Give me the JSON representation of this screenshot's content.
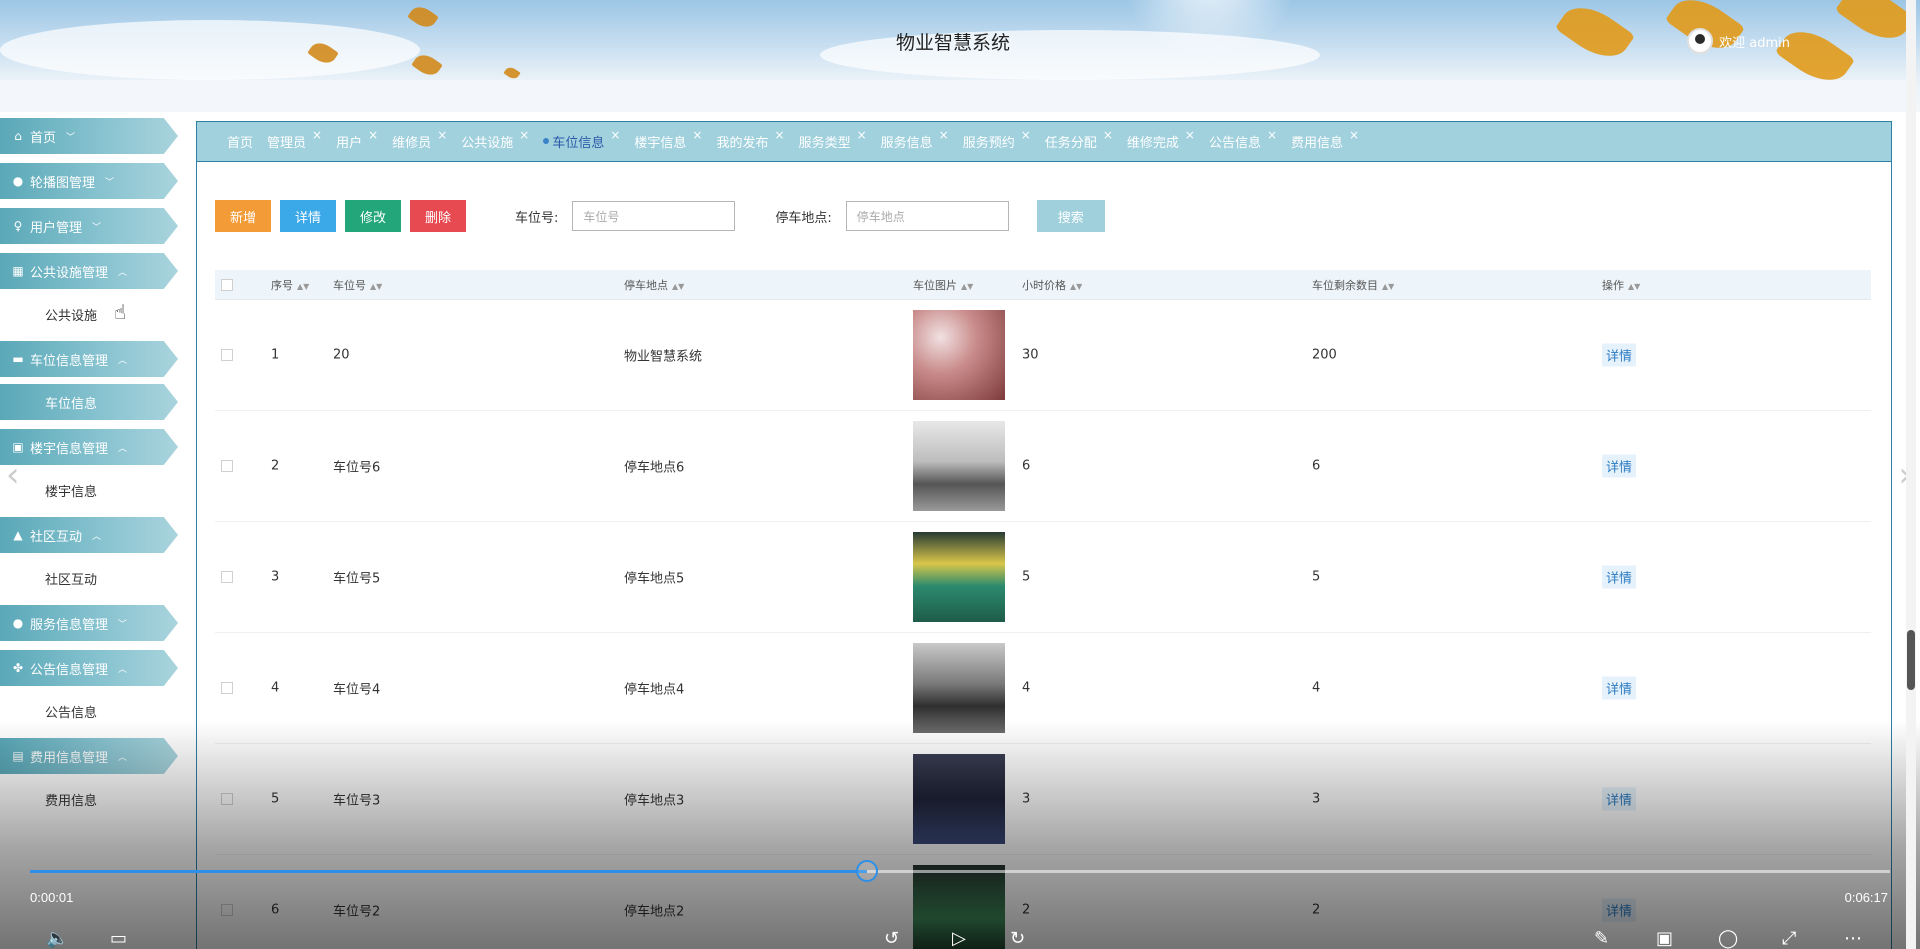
{
  "header": {
    "title": "物业智慧系统",
    "welcome": "欢迎 admin"
  },
  "sidebar": [
    {
      "label": "首页",
      "icon": "home-icon",
      "expanded": false,
      "children": []
    },
    {
      "label": "轮播图管理",
      "icon": "image-icon",
      "expanded": false,
      "children": []
    },
    {
      "label": "用户管理",
      "icon": "user-icon",
      "expanded": false,
      "children": []
    },
    {
      "label": "公共设施管理",
      "icon": "grid-icon",
      "expanded": true,
      "children": [
        "公共设施"
      ]
    },
    {
      "label": "车位信息管理",
      "icon": "car-icon",
      "expanded": true,
      "children": [
        "车位信息"
      ]
    },
    {
      "label": "楼宇信息管理",
      "icon": "building-icon",
      "expanded": true,
      "children": [
        "楼宇信息"
      ]
    },
    {
      "label": "社区互动",
      "icon": "thumb-icon",
      "expanded": true,
      "children": [
        "社区互动"
      ]
    },
    {
      "label": "服务信息管理",
      "icon": "service-icon",
      "expanded": false,
      "children": []
    },
    {
      "label": "公告信息管理",
      "icon": "notice-icon",
      "expanded": true,
      "children": [
        "公告信息"
      ]
    },
    {
      "label": "费用信息管理",
      "icon": "fee-icon",
      "expanded": true,
      "children": [
        "费用信息"
      ]
    }
  ],
  "sidebar_active_child": "车位信息",
  "tabs": [
    "首页",
    "管理员",
    "用户",
    "维修员",
    "公共设施",
    "车位信息",
    "楼宇信息",
    "我的发布",
    "服务类型",
    "服务信息",
    "服务预约",
    "任务分配",
    "维修完成",
    "公告信息",
    "费用信息"
  ],
  "active_tab": "车位信息",
  "toolbar": {
    "add": "新增",
    "detail": "详情",
    "edit": "修改",
    "delete": "删除",
    "field1_label": "车位号:",
    "field1_placeholder": "车位号",
    "field2_label": "停车地点:",
    "field2_placeholder": "停车地点",
    "search": "搜索"
  },
  "table": {
    "headers": [
      "序号",
      "车位号",
      "停车地点",
      "车位图片",
      "小时价格",
      "车位剩余数目",
      "操作"
    ],
    "rows": [
      {
        "no": "1",
        "code": "20",
        "place": "物业智慧系统",
        "price": "30",
        "remain": "200",
        "action": "详情",
        "img": "flowers"
      },
      {
        "no": "2",
        "code": "车位号6",
        "place": "停车地点6",
        "price": "6",
        "remain": "6",
        "action": "详情",
        "img": "garage-white"
      },
      {
        "no": "3",
        "code": "车位号5",
        "place": "停车地点5",
        "price": "5",
        "remain": "5",
        "action": "详情",
        "img": "garage-green"
      },
      {
        "no": "4",
        "code": "车位号4",
        "place": "停车地点4",
        "price": "4",
        "remain": "4",
        "action": "详情",
        "img": "garage-gray"
      },
      {
        "no": "5",
        "code": "车位号3",
        "place": "停车地点3",
        "price": "3",
        "remain": "3",
        "action": "详情",
        "img": "garage-dark"
      },
      {
        "no": "6",
        "code": "车位号2",
        "place": "停车地点2",
        "price": "2",
        "remain": "2",
        "action": "详情",
        "img": "garage-green-dark"
      }
    ]
  },
  "video": {
    "current_time": "0:00:01",
    "total_time": "0:06:17",
    "progress": 0.45
  }
}
